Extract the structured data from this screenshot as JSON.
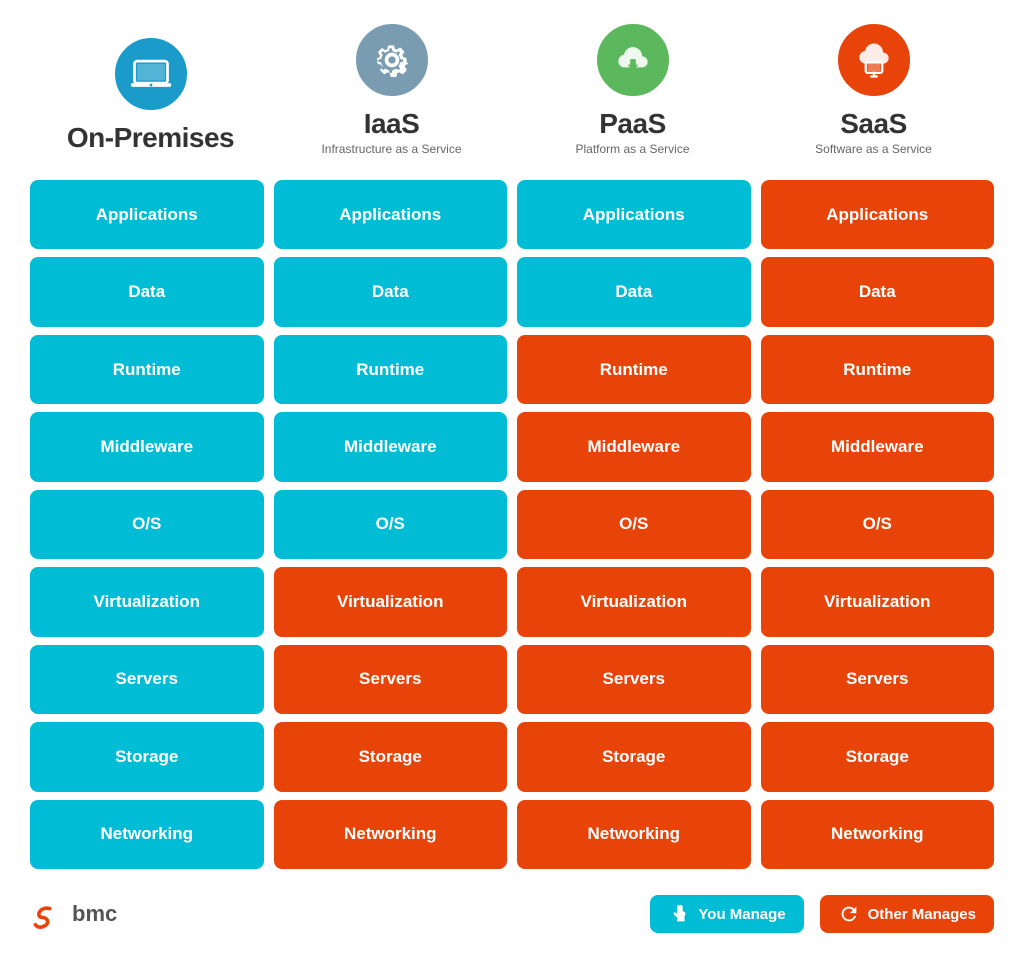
{
  "columns": [
    {
      "id": "on-premises",
      "title": "On-Premises",
      "subtitle": "",
      "icon_color": "#1a9bca",
      "icon_type": "laptop"
    },
    {
      "id": "iaas",
      "title": "IaaS",
      "subtitle": "Infrastructure as a Service",
      "icon_color": "#7a9cb0",
      "icon_type": "gear"
    },
    {
      "id": "paas",
      "title": "PaaS",
      "subtitle": "Platform as a Service",
      "icon_color": "#5cb85c",
      "icon_type": "cloud-down"
    },
    {
      "id": "saas",
      "title": "SaaS",
      "subtitle": "Software as a Service",
      "icon_color": "#e8440a",
      "icon_type": "cloud-screen"
    }
  ],
  "rows": [
    {
      "label": "Applications",
      "colors": [
        "blue",
        "blue",
        "blue",
        "orange"
      ]
    },
    {
      "label": "Data",
      "colors": [
        "blue",
        "blue",
        "blue",
        "orange"
      ]
    },
    {
      "label": "Runtime",
      "colors": [
        "blue",
        "blue",
        "orange",
        "orange"
      ]
    },
    {
      "label": "Middleware",
      "colors": [
        "blue",
        "blue",
        "orange",
        "orange"
      ]
    },
    {
      "label": "O/S",
      "colors": [
        "blue",
        "blue",
        "orange",
        "orange"
      ]
    },
    {
      "label": "Virtualization",
      "colors": [
        "blue",
        "orange",
        "orange",
        "orange"
      ]
    },
    {
      "label": "Servers",
      "colors": [
        "blue",
        "orange",
        "orange",
        "orange"
      ]
    },
    {
      "label": "Storage",
      "colors": [
        "blue",
        "orange",
        "orange",
        "orange"
      ]
    },
    {
      "label": "Networking",
      "colors": [
        "blue",
        "orange",
        "orange",
        "orange"
      ]
    }
  ],
  "legend": {
    "you_manage": "You Manage",
    "other_manages": "Other Manages"
  },
  "brand": {
    "name": "bmc"
  }
}
